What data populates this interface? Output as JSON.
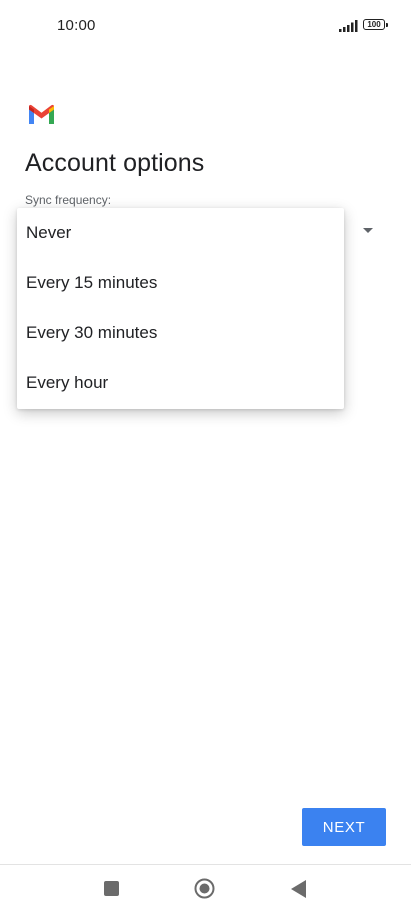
{
  "status_bar": {
    "time": "10:00",
    "battery": "100"
  },
  "app": {
    "logo": "gmail-logo"
  },
  "page": {
    "title": "Account options"
  },
  "sync": {
    "label": "Sync frequency:",
    "options": [
      "Never",
      "Every 15 minutes",
      "Every 30 minutes",
      "Every hour"
    ]
  },
  "actions": {
    "next_label": "NEXT"
  },
  "colors": {
    "next_button": "#3b82f0",
    "gmail_red": "#ea4335",
    "gmail_blue": "#4285f4",
    "gmail_green": "#34a853",
    "gmail_yellow": "#fbbc04"
  },
  "nav": {
    "icons": [
      "recents-icon",
      "home-icon",
      "back-icon"
    ]
  }
}
